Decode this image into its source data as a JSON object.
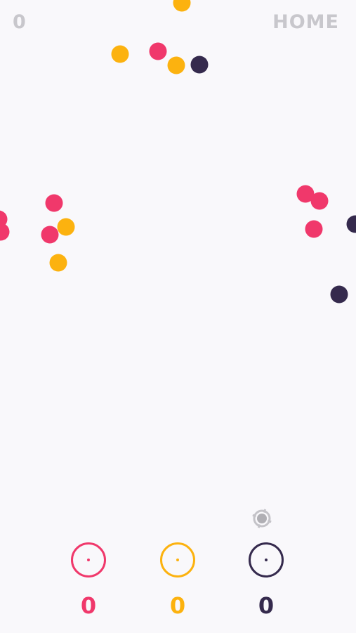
{
  "hud": {
    "score": "0",
    "home_label": "HOME"
  },
  "colors": {
    "pink": "#f0386b",
    "gold": "#fcb20f",
    "navy": "#352a4d",
    "hud_gray": "#c8c7cc"
  },
  "collectors": [
    {
      "color": "pink",
      "count": "0"
    },
    {
      "color": "gold",
      "count": "0"
    },
    {
      "color": "navy",
      "count": "0"
    }
  ],
  "shooter_icon": "crosshair-icon"
}
